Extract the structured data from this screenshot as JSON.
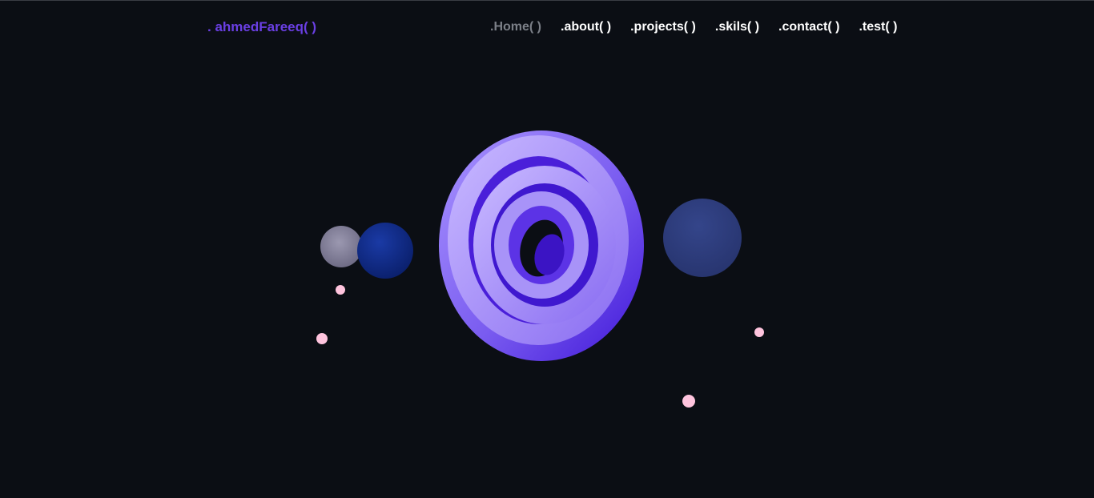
{
  "header": {
    "logo": ". ahmedFareeq( )",
    "nav": [
      {
        "label": ".Home( )",
        "active": true
      },
      {
        "label": ".about( )",
        "active": false
      },
      {
        "label": ".projects( )",
        "active": false
      },
      {
        "label": ".skils( )",
        "active": false
      },
      {
        "label": ".contact( )",
        "active": false
      },
      {
        "label": ".test( )",
        "active": false
      }
    ]
  },
  "colors": {
    "background": "#0b0e14",
    "logo": "#6a3fe3",
    "nav_text": "#ffffff",
    "nav_active": "#7b7f87",
    "torus_light": "#b7a4ff",
    "torus_dark": "#4b1fd6",
    "sphere_blue": "#0f2a8a",
    "sphere_navy": "#2b3a7a",
    "sphere_grey": "#8a87a0",
    "particle_pink": "#ffc4de"
  },
  "scene": {
    "objects": [
      "spiral-torus",
      "grey-sphere",
      "blue-sphere",
      "navy-sphere",
      "pink-particles"
    ]
  }
}
